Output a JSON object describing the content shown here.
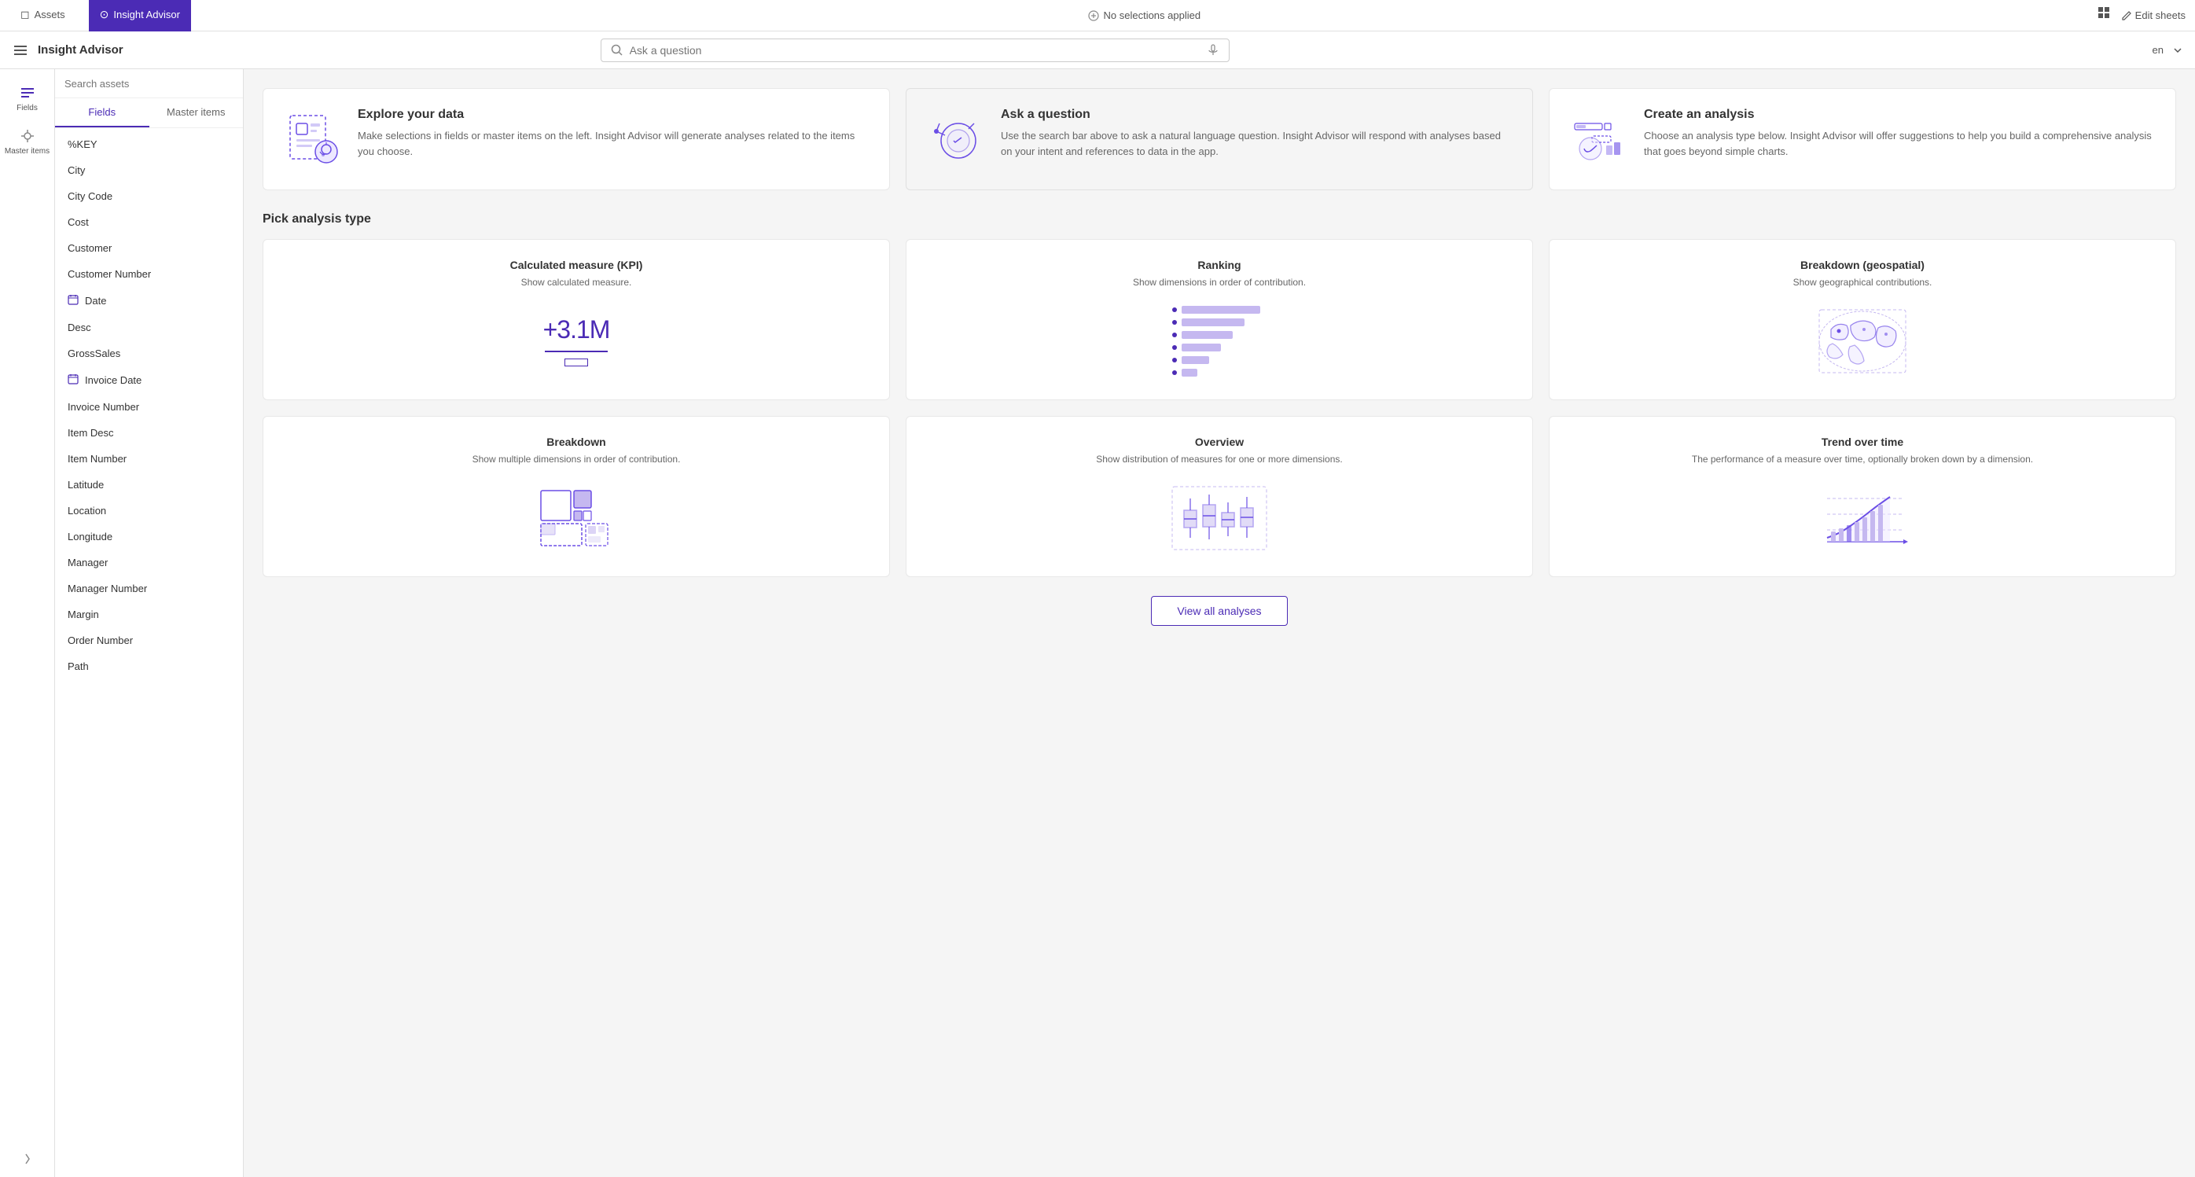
{
  "topNav": {
    "tabs": [
      {
        "id": "assets",
        "label": "Assets",
        "active": false
      },
      {
        "id": "insight-advisor",
        "label": "Insight Advisor",
        "active": true
      }
    ],
    "selectionBadge": "No selections applied",
    "editLabel": "Edit sheets"
  },
  "secondBar": {
    "title": "Insight Advisor",
    "searchPlaceholder": "Ask a question",
    "language": "en"
  },
  "leftSidebar": {
    "items": [
      {
        "id": "fields",
        "label": "Fields",
        "active": true
      },
      {
        "id": "master-items",
        "label": "Master items",
        "active": false
      }
    ],
    "collapseLabel": "Collapse"
  },
  "fieldsPanel": {
    "searchPlaceholder": "Search assets",
    "tabs": [
      {
        "id": "fields",
        "label": "Fields",
        "active": true
      },
      {
        "id": "master-items",
        "label": "Master items",
        "active": false
      }
    ],
    "fields": [
      {
        "name": "%KEY",
        "type": "text"
      },
      {
        "name": "City",
        "type": "text"
      },
      {
        "name": "City Code",
        "type": "text"
      },
      {
        "name": "Cost",
        "type": "text"
      },
      {
        "name": "Customer",
        "type": "text"
      },
      {
        "name": "Customer Number",
        "type": "text"
      },
      {
        "name": "Date",
        "type": "calendar"
      },
      {
        "name": "Desc",
        "type": "text"
      },
      {
        "name": "GrossSales",
        "type": "text"
      },
      {
        "name": "Invoice Date",
        "type": "calendar"
      },
      {
        "name": "Invoice Number",
        "type": "text"
      },
      {
        "name": "Item Desc",
        "type": "text"
      },
      {
        "name": "Item Number",
        "type": "text"
      },
      {
        "name": "Latitude",
        "type": "text"
      },
      {
        "name": "Location",
        "type": "text"
      },
      {
        "name": "Longitude",
        "type": "text"
      },
      {
        "name": "Manager",
        "type": "text"
      },
      {
        "name": "Manager Number",
        "type": "text"
      },
      {
        "name": "Margin",
        "type": "text"
      },
      {
        "name": "Order Number",
        "type": "text"
      },
      {
        "name": "Path",
        "type": "text"
      }
    ]
  },
  "infoCards": [
    {
      "id": "explore",
      "title": "Explore your data",
      "description": "Make selections in fields or master items on the left. Insight Advisor will generate analyses related to the items you choose."
    },
    {
      "id": "ask",
      "title": "Ask a question",
      "description": "Use the search bar above to ask a natural language question. Insight Advisor will respond with analyses based on your intent and references to data in the app."
    },
    {
      "id": "create",
      "title": "Create an analysis",
      "description": "Choose an analysis type below. Insight Advisor will offer suggestions to help you build a comprehensive analysis that goes beyond simple charts."
    }
  ],
  "analysisSection": {
    "title": "Pick analysis type",
    "types": [
      {
        "id": "kpi",
        "title": "Calculated measure (KPI)",
        "description": "Show calculated measure.",
        "kpiValue": "+3.1M"
      },
      {
        "id": "ranking",
        "title": "Ranking",
        "description": "Show dimensions in order of contribution.",
        "bars": [
          100,
          80,
          65,
          50,
          35,
          20
        ]
      },
      {
        "id": "geo",
        "title": "Breakdown (geospatial)",
        "description": "Show geographical contributions."
      },
      {
        "id": "breakdown",
        "title": "Breakdown",
        "description": "Show multiple dimensions in order of contribution."
      },
      {
        "id": "overview",
        "title": "Overview",
        "description": "Show distribution of measures for one or more dimensions."
      },
      {
        "id": "trend",
        "title": "Trend over time",
        "description": "The performance of a measure over time, optionally broken down by a dimension."
      }
    ],
    "viewAllLabel": "View all analyses"
  }
}
